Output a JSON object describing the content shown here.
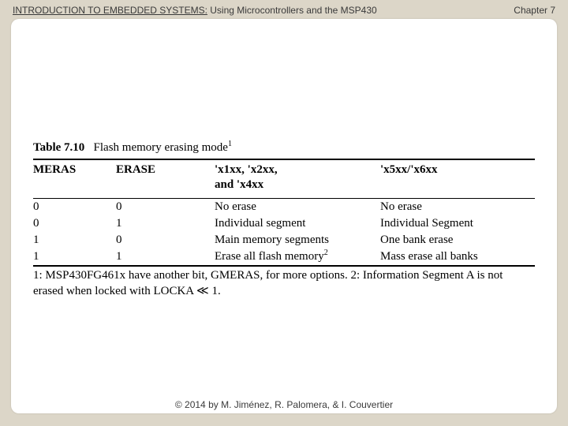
{
  "header": {
    "title_prefix": "INTRODUCTION TO EMBEDDED SYSTEMS:",
    "title_suffix": " Using Microcontrollers and the MSP430",
    "chapter": "Chapter 7"
  },
  "table": {
    "number": "Table 7.10",
    "caption": "Flash memory erasing mode",
    "caption_sup": "1",
    "headers": {
      "c1": "MERAS",
      "c2": "ERASE",
      "c3a": "'x1xx, 'x2xx,",
      "c3b": "and 'x4xx",
      "c4": "'x5xx/'x6xx"
    },
    "rows": [
      {
        "c1": "0",
        "c2": "0",
        "c3": "No erase",
        "c3_sup": "",
        "c4": "No erase"
      },
      {
        "c1": "0",
        "c2": "1",
        "c3": "Individual segment",
        "c3_sup": "",
        "c4": "Individual Segment"
      },
      {
        "c1": "1",
        "c2": "0",
        "c3": "Main memory segments",
        "c3_sup": "",
        "c4": "One bank erase"
      },
      {
        "c1": "1",
        "c2": "1",
        "c3": "Erase all flash memory",
        "c3_sup": "2",
        "c4": "Mass erase all banks"
      }
    ],
    "footnote": "1: MSP430FG461x have another bit, GMERAS, for more options. 2: Information Segment A is not erased when locked with LOCKA ≪ 1."
  },
  "footer": "© 2014 by M. Jiménez, R. Palomera, & I. Couvertier"
}
